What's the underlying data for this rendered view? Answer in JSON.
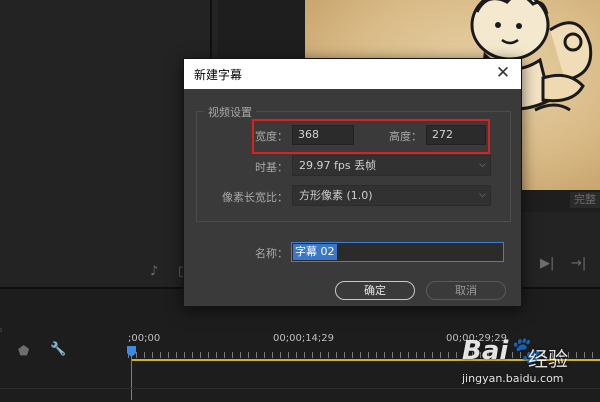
{
  "dialog": {
    "title": "新建字幕",
    "close_glyph": "✕",
    "video_settings_legend": "视频设置",
    "width_label": "宽度：",
    "width_value": "368",
    "height_label": "高度：",
    "height_value": "272",
    "timebase_label": "时基：",
    "timebase_value": "29.97 fps 丢帧",
    "pixel_aspect_label": "像素长宽比：",
    "pixel_aspect_value": "方形像素 (1.0)",
    "name_label": "名称：",
    "name_value": "字幕 02",
    "ok_label": "确定",
    "cancel_label": "取消",
    "highlight_color": "#dd1f1f"
  },
  "program_monitor": {
    "fit_label": "完整"
  },
  "timeline": {
    "timecodes": [
      ";00;00",
      "00;00;14;29",
      "00;00;29;29"
    ],
    "playhead_color": "#3c8ae6",
    "work_area_color": "#cdb32c"
  },
  "watermark": {
    "logo": "Bai",
    "logo_icon": "paw-icon",
    "text": "经验",
    "url": "jingyan.baidu.com"
  }
}
